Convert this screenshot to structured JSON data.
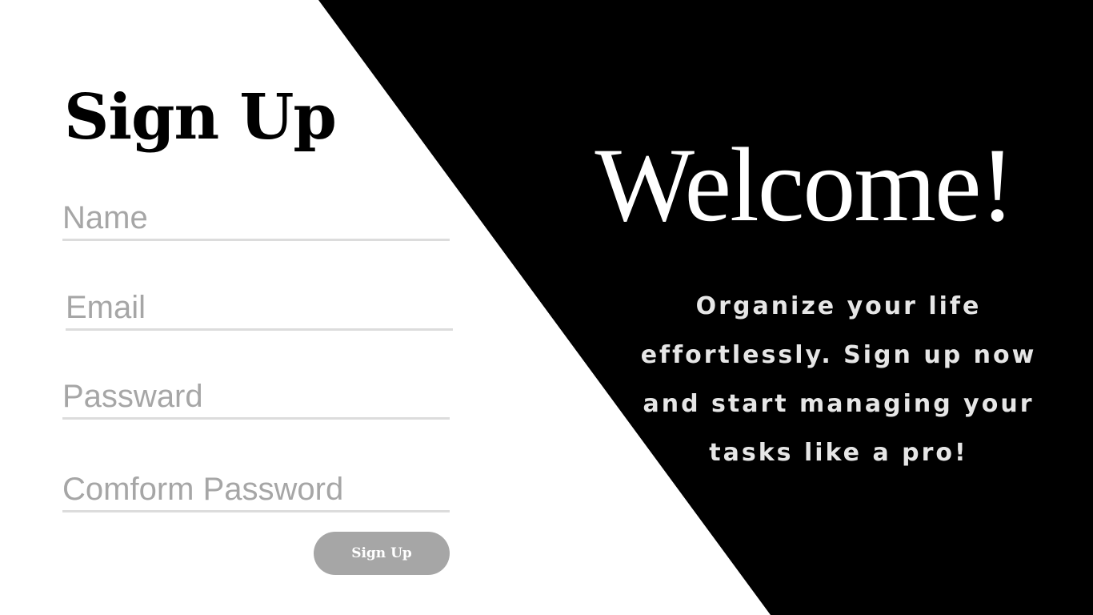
{
  "colors": {
    "panel": "#000000",
    "background": "#ffffff",
    "field_underline": "#dcdcdc",
    "placeholder": "#a6a6a6",
    "button": "#a6a6a6"
  },
  "form": {
    "title": "Sign Up",
    "fields": {
      "name": {
        "value": "",
        "placeholder": "Name"
      },
      "email": {
        "value": "",
        "placeholder": "Email"
      },
      "password": {
        "value": "",
        "placeholder": "Passward"
      },
      "confirm_password": {
        "value": "",
        "placeholder": "Comform Password"
      }
    },
    "submit_label": "Sign Up"
  },
  "hero": {
    "heading": "Welcome!",
    "tagline_lines": [
      "Organize your life",
      "effortlessly. Sign up now",
      "and start managing your",
      "tasks like a pro!"
    ]
  }
}
